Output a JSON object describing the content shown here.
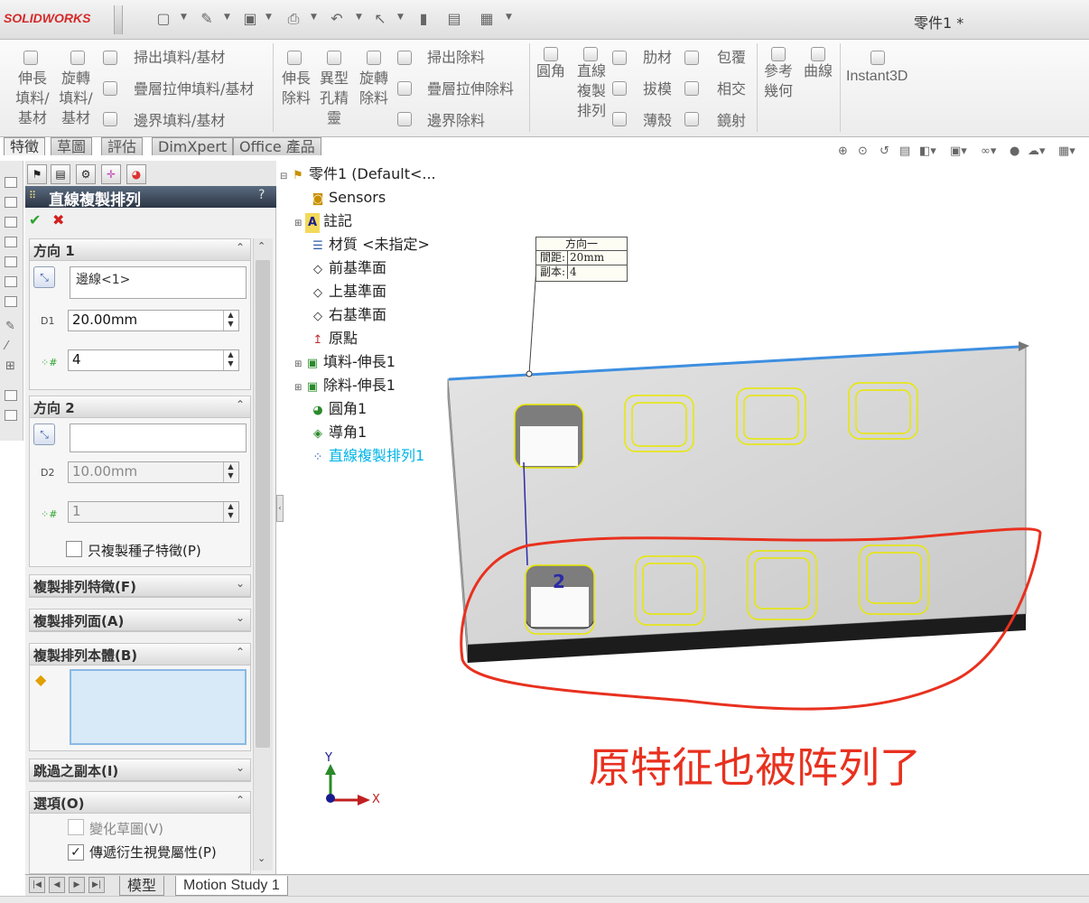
{
  "app": {
    "logo": "SOLIDWORKS",
    "document_title": "零件1 *"
  },
  "ribbon": {
    "extrude_boss": [
      "伸長",
      "填料/",
      "基材"
    ],
    "revolve_boss": [
      "旋轉",
      "填料/",
      "基材"
    ],
    "sweep_boss": "掃出填料/基材",
    "loft_boss": "疊層拉伸填料/基材",
    "boundary_boss": "邊界填料/基材",
    "extrude_cut": [
      "伸長",
      "除料"
    ],
    "hole_wizard": [
      "異型",
      "孔精",
      "靈"
    ],
    "revolve_cut": [
      "旋轉",
      "除料"
    ],
    "sweep_cut": "掃出除料",
    "loft_cut": "疊層拉伸除料",
    "boundary_cut": "邊界除料",
    "fillet": "圓角",
    "linear_pattern": [
      "直線",
      "複製",
      "排列"
    ],
    "rib": "肋材",
    "draft": "拔模",
    "shell": "薄殼",
    "wrap": "包覆",
    "intersect": "相交",
    "mirror": "鏡射",
    "ref_geometry": [
      "參考",
      "幾何"
    ],
    "curves": "曲線",
    "instant3d": "Instant3D"
  },
  "command_tabs": [
    "特徵",
    "草圖",
    "評估",
    "DimXpert",
    "Office 產品"
  ],
  "property_manager": {
    "title": "直線複製排列",
    "help": "?",
    "ok": "✔",
    "cancel": "✖",
    "direction1": {
      "title": "方向 1",
      "edge": "邊線<1>",
      "spacing": "20.00mm",
      "instances": "4"
    },
    "direction2": {
      "title": "方向 2",
      "edge": "",
      "spacing": "10.00mm",
      "instances": "1",
      "seed_only_label": "只複製種子特徵(P)"
    },
    "features_section": "複製排列特徵(F)",
    "faces_section": "複製排列面(A)",
    "bodies_section": "複製排列本體(B)",
    "skip_section": "跳過之副本(I)",
    "options_section": "選項(O)",
    "vary_sketch_label": "變化草圖(V)",
    "propagate_label": "傳遞衍生視覺屬性(P)"
  },
  "tree": {
    "root": "零件1  (Default<...",
    "items": [
      "Sensors",
      "註記",
      "材質 <未指定>",
      "前基準面",
      "上基準面",
      "右基準面",
      "原點",
      "填料-伸長1",
      "除料-伸長1",
      "圓角1",
      "導角1",
      "直線複製排列1"
    ]
  },
  "callout": {
    "title": "方向一",
    "spacing_label": "間距:",
    "spacing_value": "20mm",
    "count_label": "副本:",
    "count_value": "4"
  },
  "viewport": {
    "instance_label": "2",
    "axis_x": "X",
    "axis_y": "Y"
  },
  "annotation": "原特征也被阵列了",
  "bottom_tabs": [
    "模型",
    "Motion Study 1"
  ],
  "colors": {
    "accent": "#2b3544",
    "highlight": "#00a0e0",
    "annotation": "#e8311f",
    "pattern_preview": "#e8e800"
  }
}
